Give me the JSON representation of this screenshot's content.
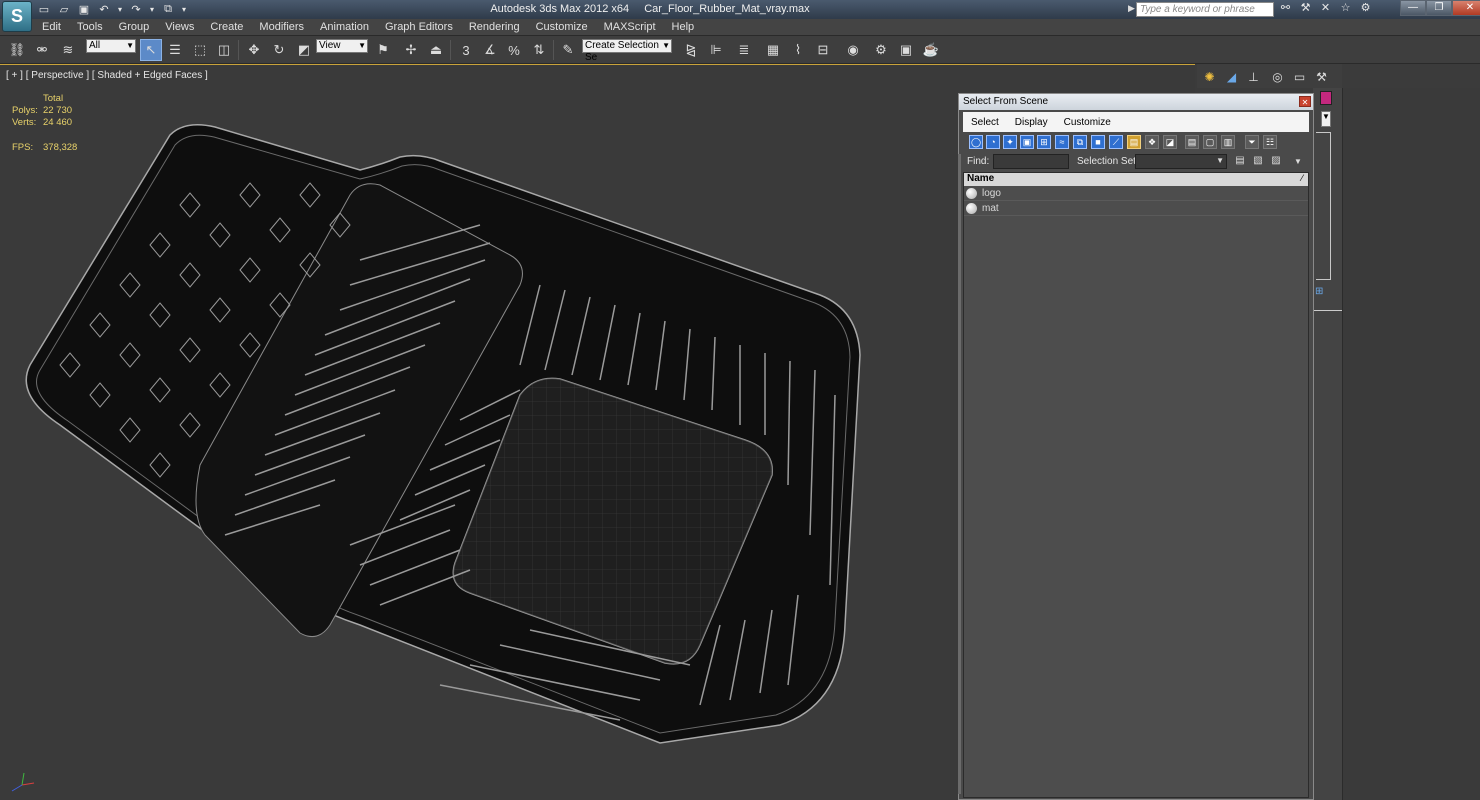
{
  "app": {
    "logo_letter": "S",
    "title_app": "Autodesk 3ds Max  2012 x64",
    "title_file": "Car_Floor_Rubber_Mat_vray.max",
    "search_placeholder": "Type a keyword or phrase"
  },
  "menu": [
    "Edit",
    "Tools",
    "Group",
    "Views",
    "Create",
    "Modifiers",
    "Animation",
    "Graph Editors",
    "Rendering",
    "Customize",
    "MAXScript",
    "Help"
  ],
  "toolbar": {
    "filter_value": "All",
    "coord_value": "View",
    "selection_set_placeholder": "Create Selection Se",
    "snap_label": "3",
    "percent_label": "%"
  },
  "viewport": {
    "label": "[ + ] [ Perspective ] [ Shaded + Edged Faces ]",
    "stats_header": "Total",
    "stats": [
      {
        "key": "Polys:",
        "value": "22 730"
      },
      {
        "key": "Verts:",
        "value": "24 460"
      },
      {
        "key": "FPS:",
        "value": "378,328"
      }
    ]
  },
  "dialog": {
    "title": "Select From Scene",
    "menu": [
      "Select",
      "Display",
      "Customize"
    ],
    "find_label": "Find:",
    "selection_set_label": "Selection Set:",
    "column_name": "Name",
    "objects": [
      "logo",
      "mat"
    ]
  },
  "colors": {
    "accent_blue": "#5c8ac8",
    "object_color": "#c4287e",
    "stats_yellow": "#e8d26a",
    "viewport_border": "#c9a33a"
  }
}
